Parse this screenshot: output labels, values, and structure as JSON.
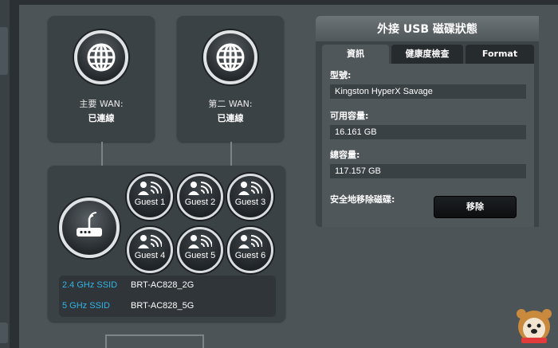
{
  "wan": {
    "primary": {
      "label": "主要 WAN:",
      "status": "已連線"
    },
    "secondary": {
      "label": "第二 WAN:",
      "status": "已連線"
    }
  },
  "guests": [
    "Guest 1",
    "Guest 2",
    "Guest 3",
    "Guest 4",
    "Guest 5",
    "Guest 6"
  ],
  "ssid": [
    {
      "label": "2.4 GHz SSID",
      "value": "BRT-AC828_2G"
    },
    {
      "label": "5 GHz SSID",
      "value": "BRT-AC828_5G"
    }
  ],
  "usb_panel": {
    "title": "外接 USB 磁碟狀態",
    "tabs": [
      "資訊",
      "健康度檢查",
      "Format"
    ],
    "model_label": "型號:",
    "model_value": "Kingston HyperX Savage",
    "available_label": "可用容量:",
    "available_value": "16.161 GB",
    "total_label": "總容量:",
    "total_value": "117.157 GB",
    "eject_label": "安全地移除磁碟:",
    "eject_button": "移除"
  },
  "colors": {
    "accent": "#33b5e5",
    "background": "#4d5458",
    "card": "#3b4246"
  }
}
